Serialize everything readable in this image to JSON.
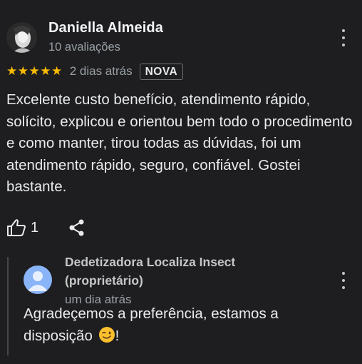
{
  "review": {
    "reviewer_name": "Daniella Almeida",
    "review_count": "10 avaliações",
    "stars": "★★★★★",
    "rating": 5,
    "date": "2 dias atrás",
    "badge": "NOVA",
    "text": "Excelente custo benefício, atendimento rápido, solícito, explicou e orientou bem todo o procedimento e como manter, tirou todas as dúvidas, foi um atendimento rápido, seguro, confiável. Gostei bastante.",
    "like_count": "1"
  },
  "owner_reply": {
    "name": "Dedetizadora Localiza Insect (proprietário)",
    "date": "um dia atrás",
    "text": "Agradeçemos a preferência, estamos a disposição",
    "trailing": "!"
  },
  "icons": {
    "more": "more-vert-icon",
    "like": "thumb-up-icon",
    "share": "share-icon",
    "emoji": "winking-face-emoji"
  },
  "colors": {
    "background": "#1e1e20",
    "star": "#fbbc04",
    "owner_avatar": "#8ab4f8"
  }
}
